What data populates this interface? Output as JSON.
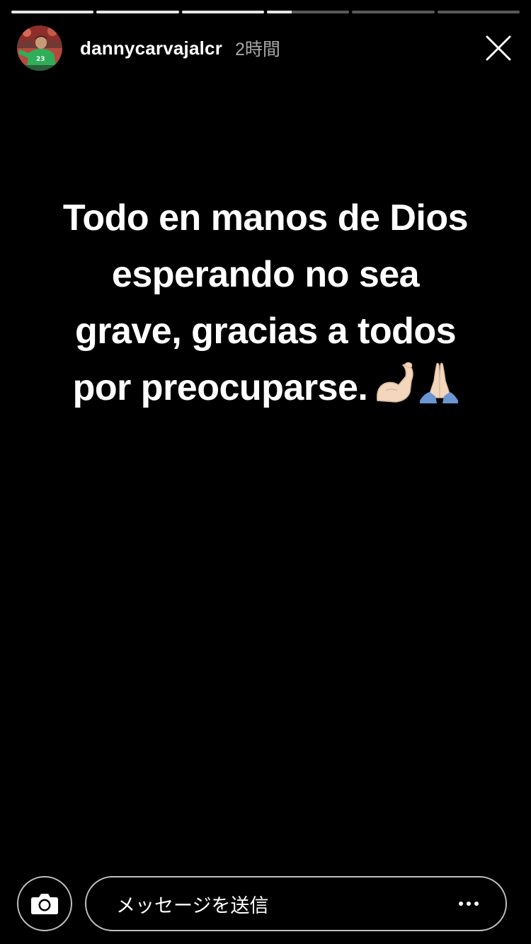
{
  "story": {
    "progress_segments": [
      {
        "fill": 1.0
      },
      {
        "fill": 1.0
      },
      {
        "fill": 1.0
      },
      {
        "fill": 0.3
      },
      {
        "fill": 0.0
      },
      {
        "fill": 0.0
      }
    ],
    "author": {
      "username": "dannycarvajalcr",
      "timestamp": "2時間",
      "avatar_icon": "profile-avatar"
    },
    "close_icon": "close-icon",
    "caption": {
      "text": "Todo en manos de Dios\nesperando no sea\ngrave,  gracias a todos\npor preocuparse.",
      "emojis": [
        "flexed-biceps-icon",
        "folded-hands-icon"
      ]
    },
    "footer": {
      "camera_icon": "camera-icon",
      "message_placeholder": "メッセージを送信",
      "more_icon": "more-dots-icon"
    },
    "colors": {
      "background": "#000000",
      "text": "#ffffff",
      "progress_filled": "#e6e6e6",
      "progress_empty": "#5a5a5a"
    }
  }
}
